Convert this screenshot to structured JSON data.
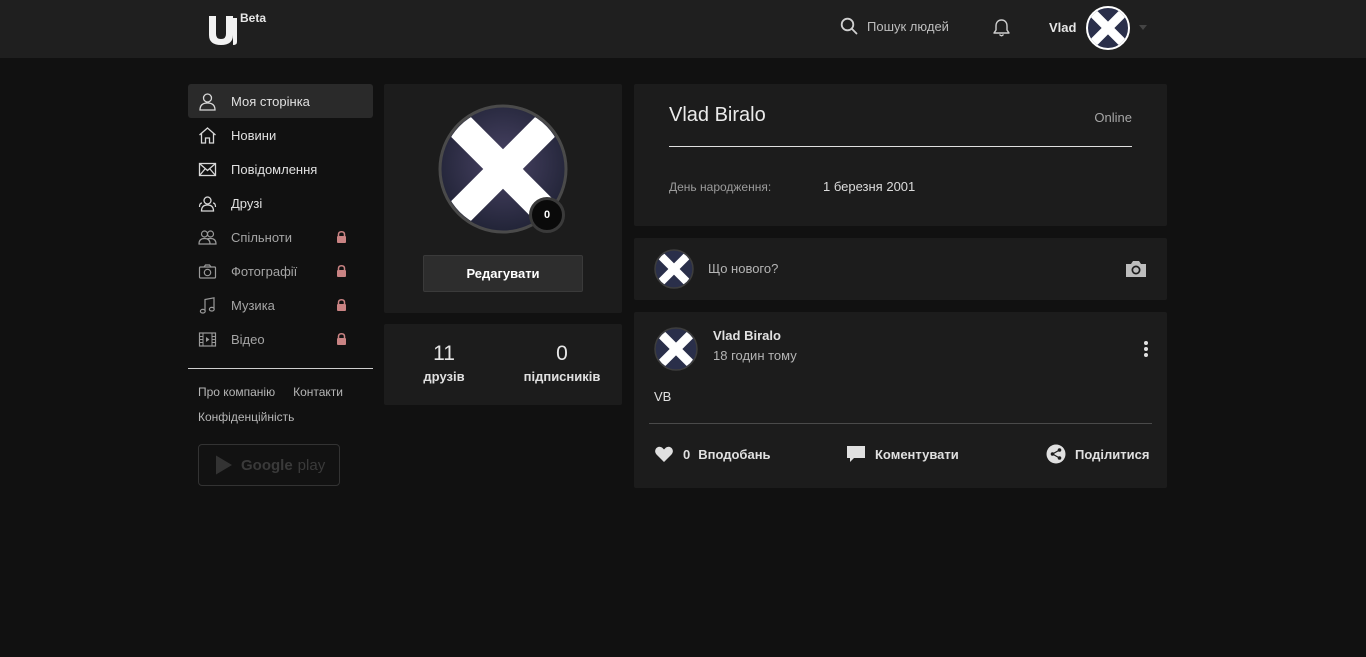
{
  "app": {
    "badge": "Beta"
  },
  "header": {
    "search_label": "Пошук людей",
    "user_name": "Vlad"
  },
  "sidebar": {
    "items": [
      {
        "label": "Моя сторінка",
        "icon": "user-icon",
        "active": true,
        "locked": false
      },
      {
        "label": "Новини",
        "icon": "home-icon",
        "active": false,
        "locked": false
      },
      {
        "label": "Повідомлення",
        "icon": "envelope-icon",
        "active": false,
        "locked": false
      },
      {
        "label": "Друзі",
        "icon": "friends-icon",
        "active": false,
        "locked": false
      },
      {
        "label": "Спільноти",
        "icon": "community-icon",
        "active": false,
        "locked": true
      },
      {
        "label": "Фотографії",
        "icon": "camera-icon",
        "active": false,
        "locked": true
      },
      {
        "label": "Музика",
        "icon": "music-note-icon",
        "active": false,
        "locked": true
      },
      {
        "label": "Відео",
        "icon": "film-icon",
        "active": false,
        "locked": true
      }
    ],
    "footer_links": {
      "about": "Про компанію",
      "contacts": "Контакти",
      "privacy": "Конфіденційність"
    },
    "google_play": {
      "brand": "Google",
      "word": "play"
    }
  },
  "profile": {
    "notifications_count": "0",
    "edit_label": "Редагувати",
    "friends_count": "11",
    "friends_label": "друзів",
    "followers_count": "0",
    "followers_label": "підписників"
  },
  "info": {
    "full_name": "Vlad Biralo",
    "status": "Online",
    "birthday_label": "День народження:",
    "birthday_value": "1 березня 2001"
  },
  "compose": {
    "placeholder": "Що нового?"
  },
  "post": {
    "author": "Vlad Biralo",
    "time": "18 годин тому",
    "text": "VB",
    "likes_count": "0",
    "like_label": "Вподобань",
    "comment_label": "Коментувати",
    "share_label": "Поділитися"
  },
  "colors": {
    "background": "#111111",
    "topbar": "#1f1f1f",
    "card": "#1c1c1c",
    "lock": "#c98383"
  }
}
